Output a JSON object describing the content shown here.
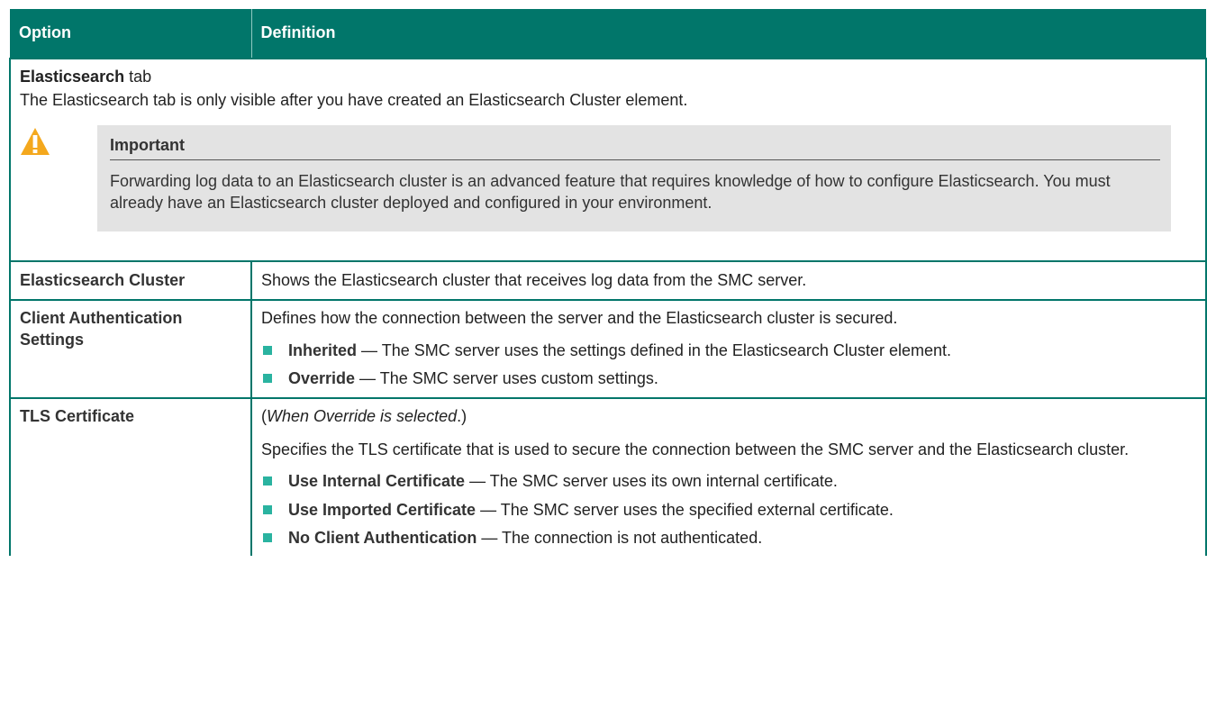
{
  "header": {
    "option": "Option",
    "definition": "Definition"
  },
  "section": {
    "title_bold": "Elasticsearch",
    "title_rest": " tab",
    "description": "The Elasticsearch tab is only visible after you have created an Elasticsearch Cluster element.",
    "note": {
      "icon": "warning-icon",
      "title": "Important",
      "text": "Forwarding log data to an Elasticsearch cluster is an advanced feature that requires knowledge of how to configure Elasticsearch. You must already have an Elasticsearch cluster deployed and configured in your environment."
    }
  },
  "rows": [
    {
      "option": "Elasticsearch Cluster",
      "definition": "Shows the Elasticsearch cluster that receives log data from the SMC server."
    },
    {
      "option": "Client Authentication Settings",
      "definition": "Defines how the connection between the server and the Elasticsearch cluster is secured.",
      "items": [
        {
          "term": "Inherited",
          "text": " — The SMC server uses the settings defined in the Elasticsearch Cluster element."
        },
        {
          "term": "Override",
          "text": " — The SMC server uses custom settings."
        }
      ]
    },
    {
      "option": "TLS Certificate",
      "condition_open": "(",
      "condition": "When Override is selected",
      "condition_close": ".)",
      "definition": "Specifies the TLS certificate that is used to secure the connection between the SMC server and the Elasticsearch cluster.",
      "items": [
        {
          "term": "Use Internal Certificate",
          "text": " — The SMC server uses its own internal certificate."
        },
        {
          "term": "Use Imported Certificate",
          "text": " — The SMC server uses the specified external certificate."
        },
        {
          "term": "No Client Authentication",
          "text": " — The connection is not authenticated."
        }
      ]
    }
  ],
  "colors": {
    "header": "#01766a",
    "bullet": "#2ab3a0",
    "note_bg": "#e3e3e3",
    "warning": "#f4a81d"
  }
}
